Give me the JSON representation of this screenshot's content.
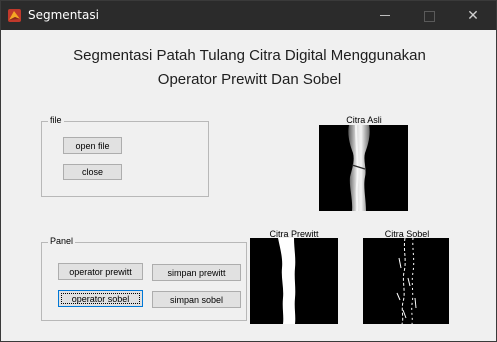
{
  "window": {
    "title": "Segmentasi",
    "min_glyph": "—",
    "close_glyph": "✕"
  },
  "heading": {
    "line1": "Segmentasi Patah Tulang Citra Digital Menggunakan",
    "line2": "Operator Prewitt Dan Sobel"
  },
  "file_panel": {
    "title": "file",
    "open_label": "open file",
    "close_label": "close"
  },
  "panel": {
    "title": "Panel",
    "prewitt_label": "operator prewitt",
    "simpan_prewitt_label": "simpan prewitt",
    "sobel_label": "operator sobel",
    "simpan_sobel_label": "simpan sobel"
  },
  "images": {
    "asli_label": "Citra Asli",
    "prewitt_label": "Citra Prewitt",
    "sobel_label": "Citra Sobel"
  },
  "colors": {
    "titlebar": "#2b2b2b",
    "window_bg": "#f0f0f0",
    "focus_border": "#0078d7"
  }
}
